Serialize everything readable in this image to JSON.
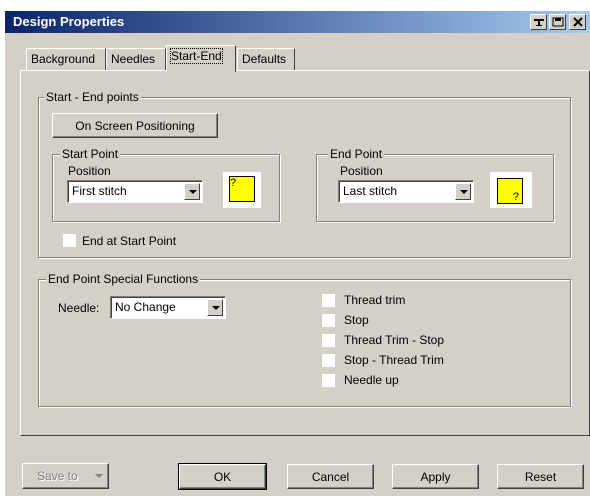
{
  "window": {
    "title": "Design Properties"
  },
  "titlebar_buttons": [
    "help-pin-icon",
    "save-icon",
    "close-icon"
  ],
  "tabs": [
    {
      "label": "Background"
    },
    {
      "label": "Needles"
    },
    {
      "label": "Start-End"
    },
    {
      "label": "Defaults"
    }
  ],
  "start_end": {
    "group_label": "Start - End points",
    "on_screen_button": "On Screen Positioning",
    "start_point": {
      "group_label": "Start Point",
      "position_label": "Position",
      "position_value": "First stitch",
      "marker": "?"
    },
    "end_point": {
      "group_label": "End Point",
      "position_label": "Position",
      "position_value": "Last stitch",
      "marker": "?"
    },
    "end_at_start_label": "End at Start Point",
    "end_at_start_checked": false
  },
  "special": {
    "group_label": "End Point Special Functions",
    "needle_label": "Needle:",
    "needle_value": "No Change",
    "options": [
      {
        "label": "Thread trim",
        "checked": false
      },
      {
        "label": "Stop",
        "checked": false
      },
      {
        "label": "Thread Trim - Stop",
        "checked": false
      },
      {
        "label": "Stop - Thread Trim",
        "checked": false
      },
      {
        "label": "Needle up",
        "checked": false
      }
    ]
  },
  "buttons": {
    "save_to": "Save to",
    "ok": "OK",
    "cancel": "Cancel",
    "apply": "Apply",
    "reset": "Reset"
  },
  "colors": {
    "title_start": "#0a246a",
    "title_end": "#a6caf0",
    "face": "#d4d0c8",
    "marker": "#ffff00"
  }
}
